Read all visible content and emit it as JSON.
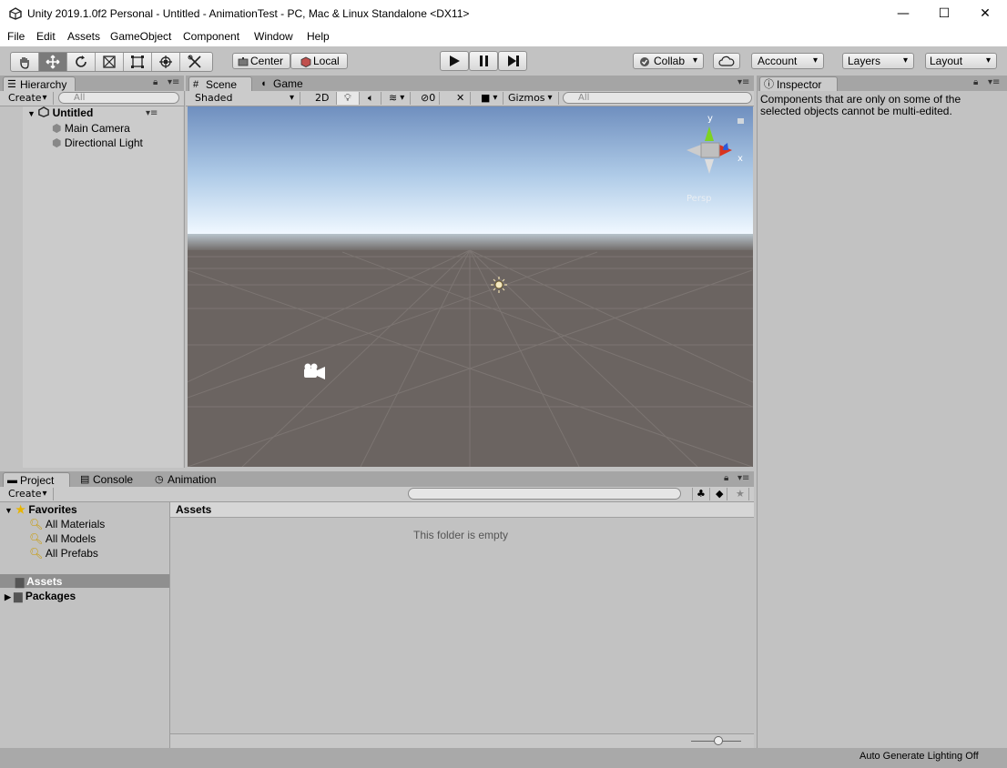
{
  "window": {
    "title": "Unity 2019.1.0f2 Personal - Untitled - AnimationTest - PC, Mac & Linux Standalone <DX11>",
    "minimize": "—",
    "maximize": "☐",
    "close": "✕"
  },
  "menu": [
    "File",
    "Edit",
    "Assets",
    "GameObject",
    "Component",
    "Window",
    "Help"
  ],
  "toolbar": {
    "tools": [
      "hand-tool-icon",
      "move-tool-icon",
      "rotate-tool-icon",
      "scale-tool-icon",
      "rect-tool-icon",
      "transform-tool-icon",
      "custom-tool-icon"
    ],
    "pivot_label": "Center",
    "space_label": "Local",
    "collab_label": "Collab",
    "account_label": "Account",
    "layers_label": "Layers",
    "layout_label": "Layout"
  },
  "hierarchy": {
    "tab_label": "Hierarchy",
    "create_label": "Create",
    "search_placeholder": "All",
    "scene_name": "Untitled",
    "items": [
      "Main Camera",
      "Directional Light"
    ]
  },
  "scene": {
    "tabs": [
      "Scene",
      "Game"
    ],
    "shading_label": "Shaded",
    "mode_2d": "2D",
    "hidden_count": "0",
    "gizmos_label": "Gizmos",
    "search_placeholder": "All",
    "gizmo_y": "y",
    "gizmo_x": "x",
    "persp_label": "Persp",
    "colors": {
      "sky_top": "#6f8fbf",
      "horizon": "#f0f8ff",
      "ground": "#6b6461"
    }
  },
  "inspector": {
    "tab_label": "Inspector",
    "message": "Components that are only on some of the selected objects cannot be multi-edited."
  },
  "project": {
    "tabs": [
      "Project",
      "Console",
      "Animation"
    ],
    "create_label": "Create",
    "favorites_label": "Favorites",
    "favorites": [
      "All Materials",
      "All Models",
      "All Prefabs"
    ],
    "folders": [
      "Assets",
      "Packages"
    ],
    "breadcrumb": "Assets",
    "empty_message": "This folder is empty"
  },
  "status": {
    "lighting": "Auto Generate Lighting Off"
  }
}
